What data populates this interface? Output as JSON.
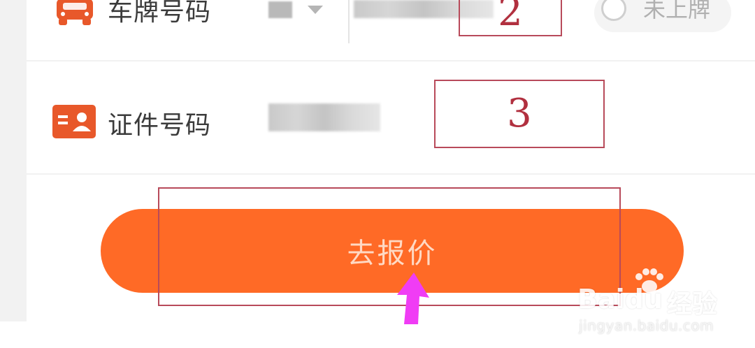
{
  "form": {
    "plate_row": {
      "label": "车牌号码",
      "icon": "car-icon",
      "province_icon": "dropdown-caret-icon",
      "unplated_option": "未上牌"
    },
    "id_row": {
      "label": "证件号码",
      "icon": "id-card-icon"
    },
    "submit_label": "去报价"
  },
  "annotations": {
    "box_2": "2",
    "box_3": "3",
    "arrow": "pointer-arrow-icon"
  },
  "watermark": {
    "brand": "Bai",
    "paw": "du",
    "suffix": "经验",
    "url": "jingyan.baidu.com"
  },
  "colors": {
    "accent": "#ff6a26",
    "icon_orange": "#e8582a",
    "annotation": "#b84a5a",
    "arrow": "#f03cf5"
  }
}
